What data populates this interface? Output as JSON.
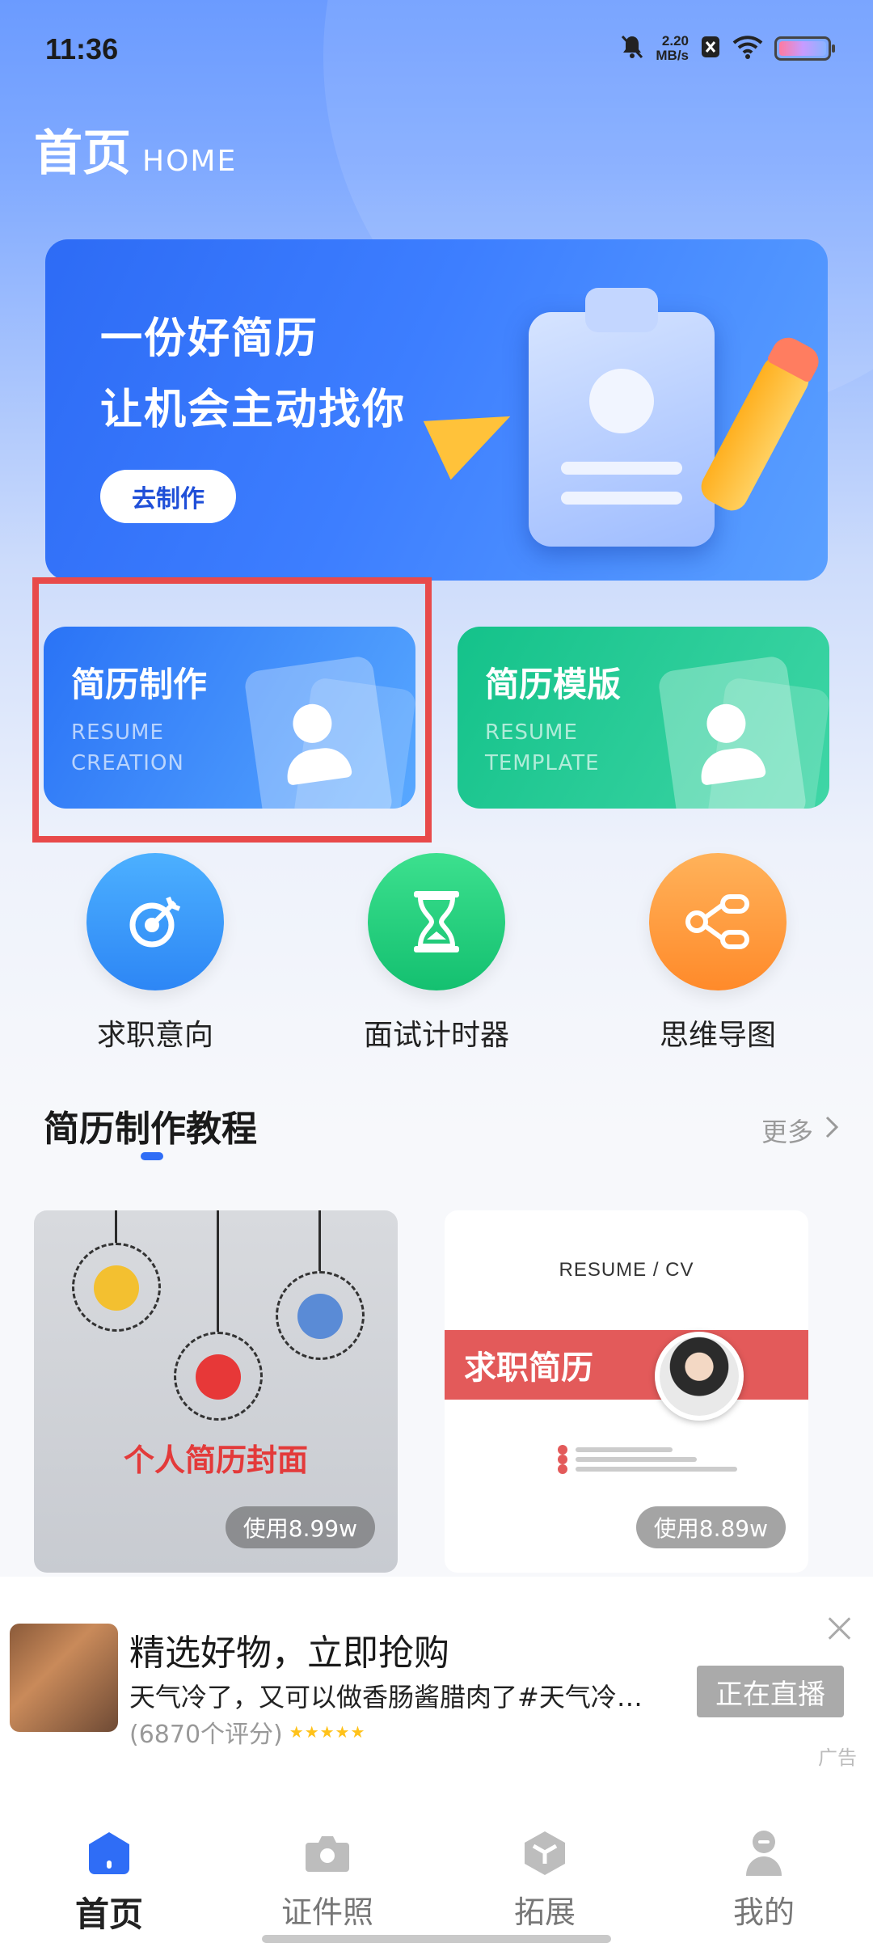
{
  "status_bar": {
    "time": "11:36",
    "net_speed_value": "2.20",
    "net_speed_unit": "MB/s"
  },
  "header": {
    "title": "首页",
    "subtitle": "HOME"
  },
  "banner": {
    "line1": "一份好简历",
    "line2": "让机会主动找你",
    "button": "去制作"
  },
  "features": [
    {
      "title": "简历制作",
      "sub1": "RESUME",
      "sub2": "CREATION"
    },
    {
      "title": "简历模版",
      "sub1": "RESUME",
      "sub2": "TEMPLATE"
    }
  ],
  "quick_tools": [
    {
      "label": "求职意向",
      "icon": "target-icon"
    },
    {
      "label": "面试计时器",
      "icon": "hourglass-icon"
    },
    {
      "label": "思维导图",
      "icon": "share-network-icon"
    }
  ],
  "tutorial": {
    "title": "简历制作教程",
    "more": "更多",
    "cards": [
      {
        "caption": "个人简历封面",
        "usage": "使用8.99w"
      },
      {
        "heading": "RESUME / CV",
        "band_title": "求职简历",
        "usage": "使用8.89w"
      }
    ]
  },
  "ad": {
    "title": "精选好物，立即抢购",
    "desc": "天气冷了，又可以做香肠酱腊肉了#天气冷…",
    "rating": "(6870个评分)",
    "stars": "★★★★★",
    "cta": "正在直播",
    "label": "广告"
  },
  "bottom_nav": [
    {
      "label": "首页",
      "icon": "home-icon",
      "active": true
    },
    {
      "label": "证件照",
      "icon": "camera-icon",
      "active": false
    },
    {
      "label": "拓展",
      "icon": "cube-icon",
      "active": false
    },
    {
      "label": "我的",
      "icon": "user-icon",
      "active": false
    }
  ],
  "colors": {
    "primary": "#2f6df6",
    "green": "#14c28a",
    "orange": "#ff8a2a",
    "highlight": "#e84a4a"
  }
}
